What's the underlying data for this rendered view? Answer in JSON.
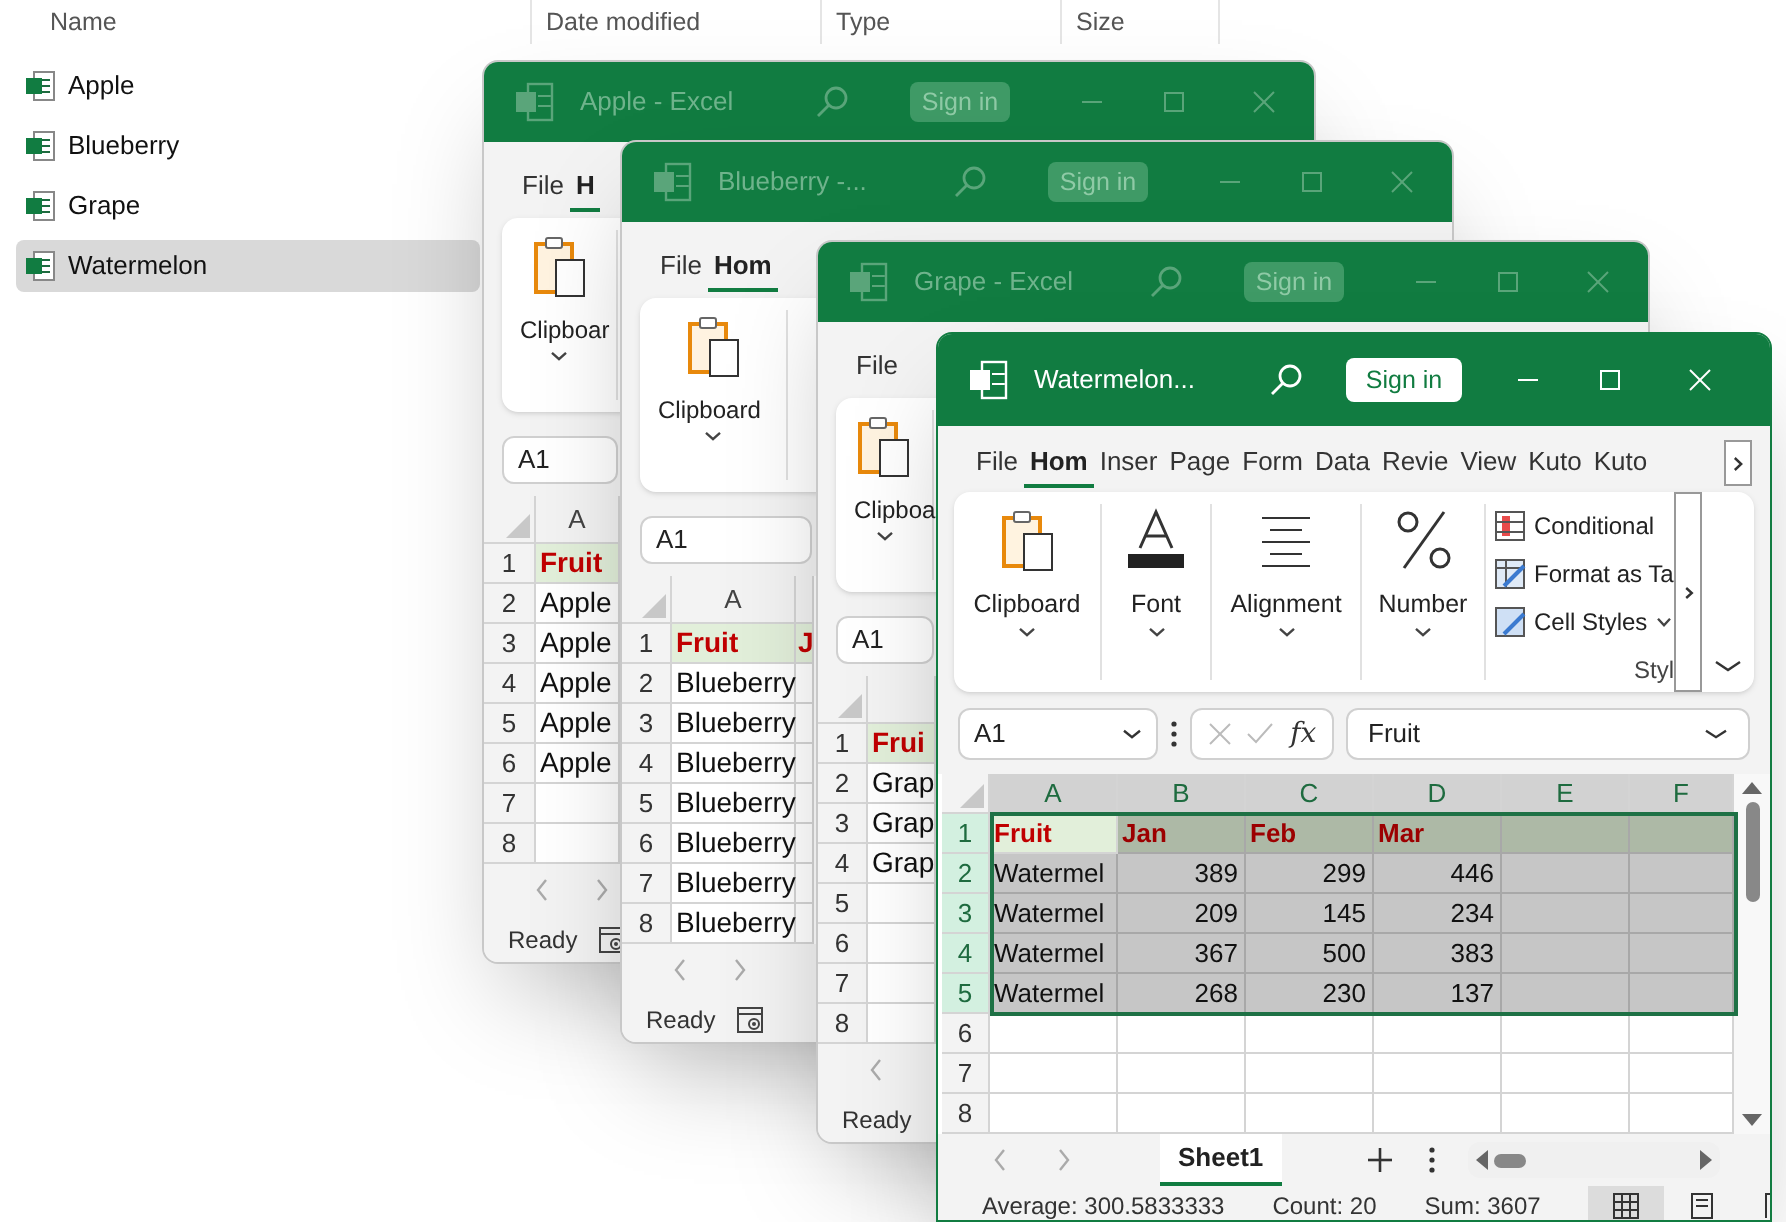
{
  "explorer": {
    "columns": [
      "Name",
      "Date modified",
      "Type",
      "Size"
    ],
    "files": [
      {
        "name": "Apple",
        "selected": false
      },
      {
        "name": "Blueberry",
        "selected": false
      },
      {
        "name": "Grape",
        "selected": false
      },
      {
        "name": "Watermelon",
        "selected": true
      }
    ]
  },
  "windows": [
    {
      "title": "Apple  -  Excel",
      "active": false,
      "sign_in": "Sign in",
      "tabs": [
        {
          "label": "File",
          "selected": false
        },
        {
          "label": "H",
          "selected": true
        }
      ],
      "ribbon_groups": [
        {
          "kind": "large",
          "label": "Clipboar"
        }
      ],
      "name_box": "A1",
      "columns": [
        {
          "label": "A",
          "selected": false
        }
      ],
      "rows": [
        {
          "header": "1",
          "kind": "header",
          "selected": false,
          "cells": [
            "Fruit"
          ]
        },
        {
          "header": "2",
          "kind": "data",
          "selected": false,
          "cells": [
            "Apple"
          ]
        },
        {
          "header": "3",
          "kind": "data",
          "selected": false,
          "cells": [
            "Apple"
          ]
        },
        {
          "header": "4",
          "kind": "data",
          "selected": false,
          "cells": [
            "Apple"
          ]
        },
        {
          "header": "5",
          "kind": "data",
          "selected": false,
          "cells": [
            "Apple"
          ]
        },
        {
          "header": "6",
          "kind": "data",
          "selected": false,
          "cells": [
            "Apple"
          ]
        },
        {
          "header": "7",
          "kind": "data",
          "selected": false,
          "cells": []
        },
        {
          "header": "8",
          "kind": "data",
          "selected": false,
          "cells": []
        }
      ],
      "status": [
        "Ready"
      ]
    },
    {
      "title": "Blueberry  -...",
      "active": false,
      "sign_in": "Sign in",
      "tabs": [
        {
          "label": "File",
          "selected": false
        },
        {
          "label": "Hom",
          "selected": true
        }
      ],
      "ribbon_groups": [
        {
          "kind": "large",
          "label": "Clipboard"
        }
      ],
      "name_box": "A1",
      "columns": [
        {
          "label": "A",
          "selected": false
        }
      ],
      "rows": [
        {
          "header": "1",
          "kind": "header",
          "selected": false,
          "cells": [
            "Fruit",
            "J"
          ]
        },
        {
          "header": "2",
          "kind": "data",
          "selected": false,
          "cells": [
            "Blueberry"
          ]
        },
        {
          "header": "3",
          "kind": "data",
          "selected": false,
          "cells": [
            "Blueberry"
          ]
        },
        {
          "header": "4",
          "kind": "data",
          "selected": false,
          "cells": [
            "Blueberry"
          ]
        },
        {
          "header": "5",
          "kind": "data",
          "selected": false,
          "cells": [
            "Blueberry"
          ]
        },
        {
          "header": "6",
          "kind": "data",
          "selected": false,
          "cells": [
            "Blueberry"
          ]
        },
        {
          "header": "7",
          "kind": "data",
          "selected": false,
          "cells": [
            "Blueberry"
          ]
        },
        {
          "header": "8",
          "kind": "data",
          "selected": false,
          "cells": [
            "Blueberry"
          ]
        }
      ],
      "status": [
        "Ready"
      ]
    },
    {
      "title": "Grape  -  Excel",
      "active": false,
      "sign_in": "Sign in",
      "tabs": [
        {
          "label": "File",
          "selected": false
        }
      ],
      "ribbon_groups": [
        {
          "kind": "large",
          "label": "Clipboa"
        }
      ],
      "name_box": "A1",
      "rows": [
        {
          "header": "1",
          "kind": "header",
          "selected": false,
          "cells": [
            "Frui"
          ]
        },
        {
          "header": "2",
          "kind": "data",
          "selected": false,
          "cells": [
            "Grap"
          ]
        },
        {
          "header": "3",
          "kind": "data",
          "selected": false,
          "cells": [
            "Grap"
          ]
        },
        {
          "header": "4",
          "kind": "data",
          "selected": false,
          "cells": [
            "Grap"
          ]
        },
        {
          "header": "5",
          "kind": "data",
          "selected": false,
          "cells": []
        },
        {
          "header": "6",
          "kind": "data",
          "selected": false,
          "cells": []
        },
        {
          "header": "7",
          "kind": "data",
          "selected": false,
          "cells": []
        },
        {
          "header": "8",
          "kind": "data",
          "selected": false,
          "cells": []
        }
      ],
      "status": [
        "Ready"
      ]
    },
    {
      "title": "Watermelon...",
      "active": true,
      "sign_in": "Sign in",
      "tabs": [
        {
          "label": "File",
          "selected": false
        },
        {
          "label": "Hom",
          "selected": true
        },
        {
          "label": "Inser",
          "selected": false
        },
        {
          "label": "Page",
          "selected": false
        },
        {
          "label": "Form",
          "selected": false
        },
        {
          "label": "Data",
          "selected": false
        },
        {
          "label": "Revie",
          "selected": false
        },
        {
          "label": "View",
          "selected": false
        },
        {
          "label": "Kuto",
          "selected": false
        },
        {
          "label": "Kuto",
          "selected": false
        }
      ],
      "ribbon_groups": [
        {
          "kind": "large",
          "label": "Clipboard"
        },
        {
          "kind": "large",
          "label": "Font"
        },
        {
          "kind": "large",
          "label": "Alignment"
        },
        {
          "kind": "large",
          "label": "Number"
        },
        {
          "kind": "list",
          "label": "Styl",
          "items": [
            {
              "label": "Conditional",
              "dropdown": false
            },
            {
              "label": "Format as Ta",
              "dropdown": false
            },
            {
              "label": "Cell Styles",
              "dropdown": true
            }
          ]
        }
      ],
      "name_box": "A1",
      "formula": {
        "function_label": "fx",
        "value": "Fruit"
      },
      "columns": [
        {
          "label": "A",
          "selected": true
        },
        {
          "label": "B",
          "selected": true
        },
        {
          "label": "C",
          "selected": true
        },
        {
          "label": "D",
          "selected": true
        },
        {
          "label": "E",
          "selected": true
        },
        {
          "label": "F",
          "selected": true
        }
      ],
      "rows": [
        {
          "header": "1",
          "kind": "header",
          "selected": true,
          "cells": [
            {
              "text": "Fruit",
              "active": true
            },
            {
              "text": "Jan",
              "active": false
            },
            {
              "text": "Feb",
              "active": false
            },
            {
              "text": "Mar",
              "active": false
            }
          ]
        },
        {
          "header": "2",
          "kind": "data",
          "selected": true,
          "cells": [
            {
              "text": "Watermel",
              "active": false
            },
            {
              "text": "389",
              "active": false
            },
            {
              "text": "299",
              "active": false
            },
            {
              "text": "446",
              "active": false
            }
          ]
        },
        {
          "header": "3",
          "kind": "data",
          "selected": true,
          "cells": [
            {
              "text": "Watermel",
              "active": false
            },
            {
              "text": "209",
              "active": false
            },
            {
              "text": "145",
              "active": false
            },
            {
              "text": "234",
              "active": false
            }
          ]
        },
        {
          "header": "4",
          "kind": "data",
          "selected": true,
          "cells": [
            {
              "text": "Watermel",
              "active": false
            },
            {
              "text": "367",
              "active": false
            },
            {
              "text": "500",
              "active": false
            },
            {
              "text": "383",
              "active": false
            }
          ]
        },
        {
          "header": "5",
          "kind": "data",
          "selected": true,
          "cells": [
            {
              "text": "Watermel",
              "active": false
            },
            {
              "text": "268",
              "active": false
            },
            {
              "text": "230",
              "active": false
            },
            {
              "text": "137",
              "active": false
            }
          ]
        },
        {
          "header": "6",
          "kind": "data",
          "selected": false,
          "cells": []
        },
        {
          "header": "7",
          "kind": "data",
          "selected": false,
          "cells": []
        },
        {
          "header": "8",
          "kind": "data",
          "selected": false,
          "cells": []
        }
      ],
      "sheets": [
        {
          "label": "Sheet1",
          "selected": true
        }
      ],
      "status": [
        "Average: 300.5833333",
        "Count: 20",
        "Sum: 3607"
      ],
      "view_modes": [
        {
          "selected": true
        },
        {
          "selected": false
        },
        {
          "selected": false
        }
      ]
    }
  ]
}
